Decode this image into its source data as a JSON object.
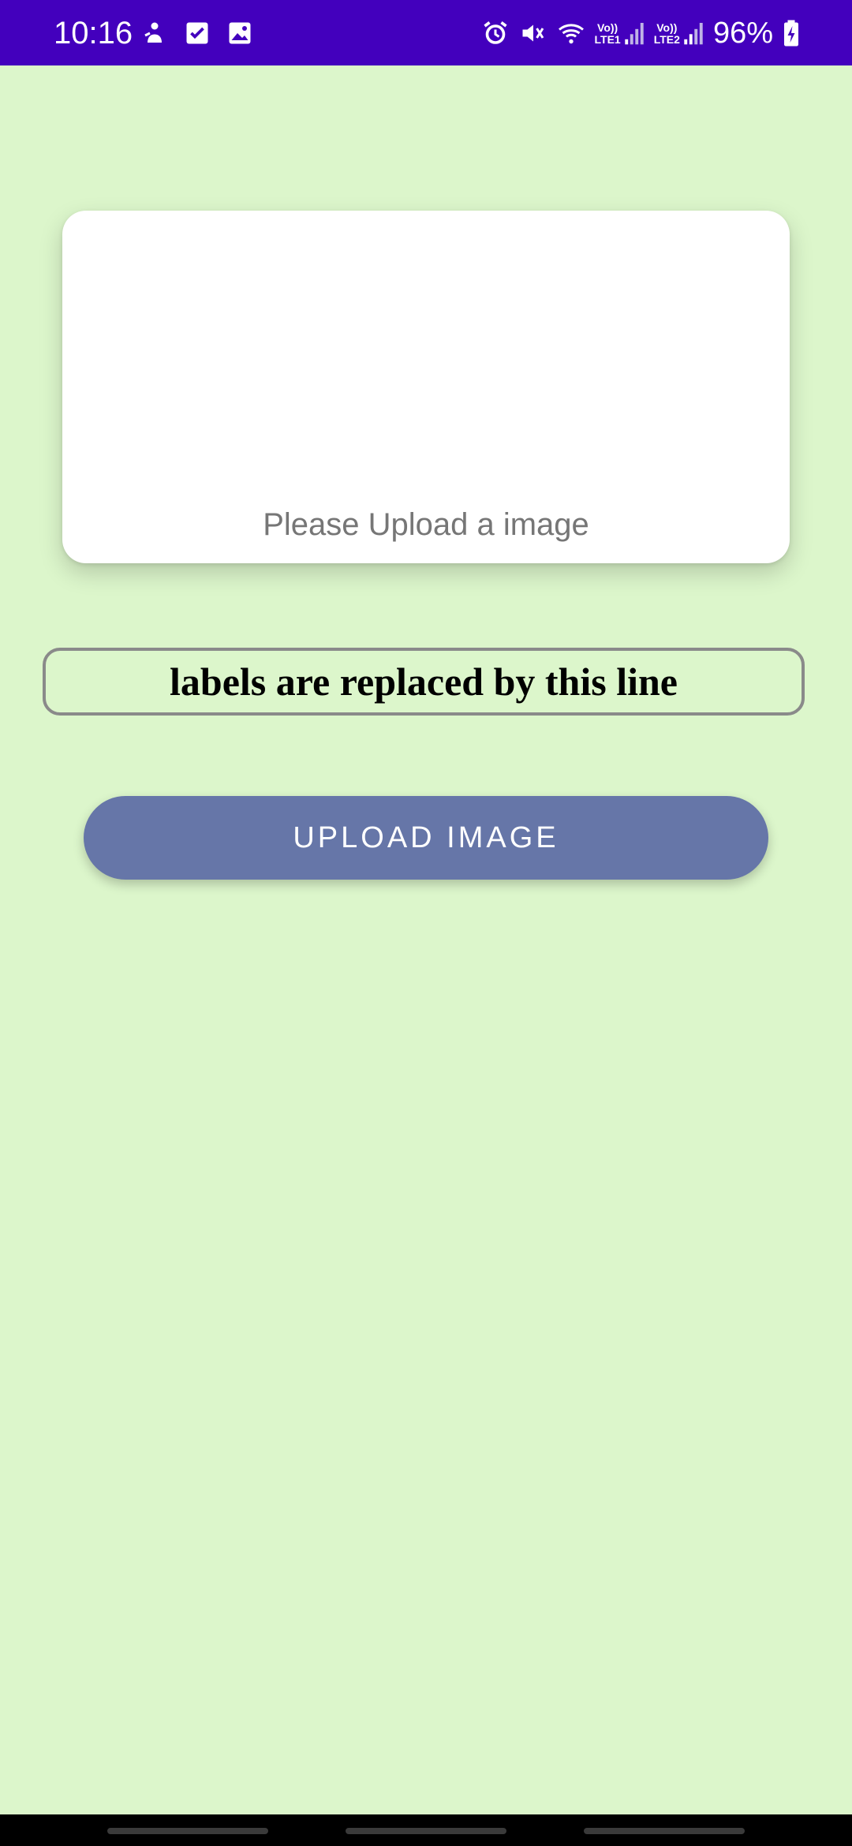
{
  "status_bar": {
    "time": "10:16",
    "left_icons": [
      "person-notification-icon",
      "checkbox-icon",
      "gallery-icon"
    ],
    "right_icons": [
      "alarm-icon",
      "vibrate-mute-icon",
      "wifi-icon"
    ],
    "sim1_label_top": "Vo))",
    "sim1_label_bottom": "LTE1",
    "sim2_label_top": "Vo))",
    "sim2_label_bottom": "LTE2",
    "battery_percent": "96%",
    "background_color": "#4300bd"
  },
  "main": {
    "background_color": "#dcf6cb",
    "image_card": {
      "caption": "Please Upload a image"
    },
    "result_label": "labels are replaced by this line",
    "upload_button_label": "UPLOAD IMAGE",
    "upload_button_color": "#6676a8"
  },
  "navigation_bar": {
    "pills": [
      "recents-pill",
      "home-pill",
      "back-pill"
    ]
  }
}
